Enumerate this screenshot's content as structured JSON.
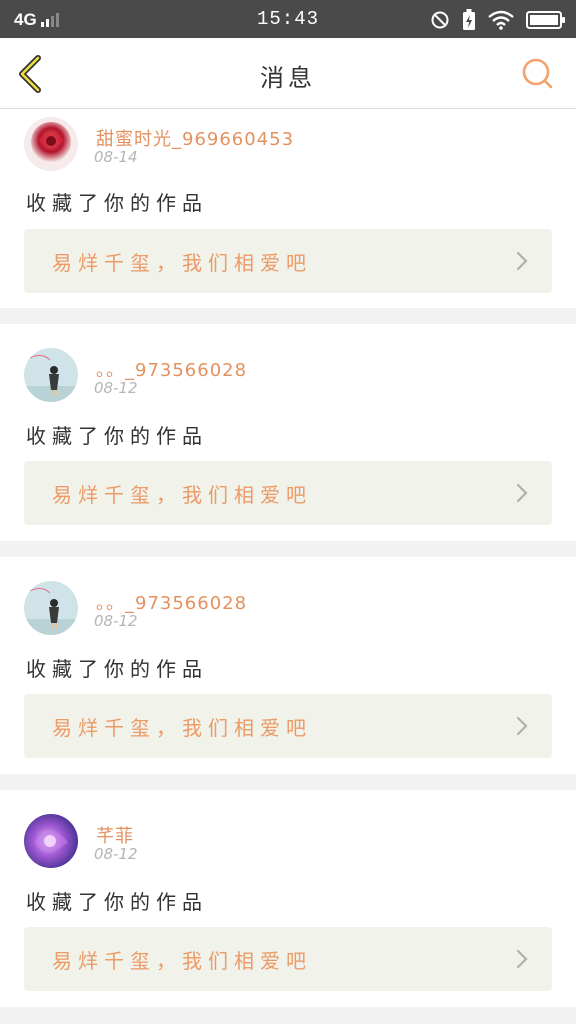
{
  "status_bar": {
    "network": "4G",
    "time": "15:43"
  },
  "header": {
    "title": "消息",
    "back_icon": "chevron-left-icon",
    "search_icon": "search-icon",
    "accent_color": "#f0a26a"
  },
  "messages": [
    {
      "username": "甜蜜时光_969660453",
      "date": "08-14",
      "action": "收藏了你的作品",
      "work_title": "易烊千玺，我们相爱吧",
      "avatar": "avatar-red-rose"
    },
    {
      "username": "。。_973566028",
      "date": "08-12",
      "action": "收藏了你的作品",
      "work_title": "易烊千玺，我们相爱吧",
      "avatar": "avatar-girl-sky"
    },
    {
      "username": "。。_973566028",
      "date": "08-12",
      "action": "收藏了你的作品",
      "work_title": "易烊千玺，我们相爱吧",
      "avatar": "avatar-girl-sky"
    },
    {
      "username": "芊菲",
      "date": "08-12",
      "action": "收藏了你的作品",
      "work_title": "易烊千玺，我们相爱吧",
      "avatar": "avatar-purple-rose"
    }
  ]
}
